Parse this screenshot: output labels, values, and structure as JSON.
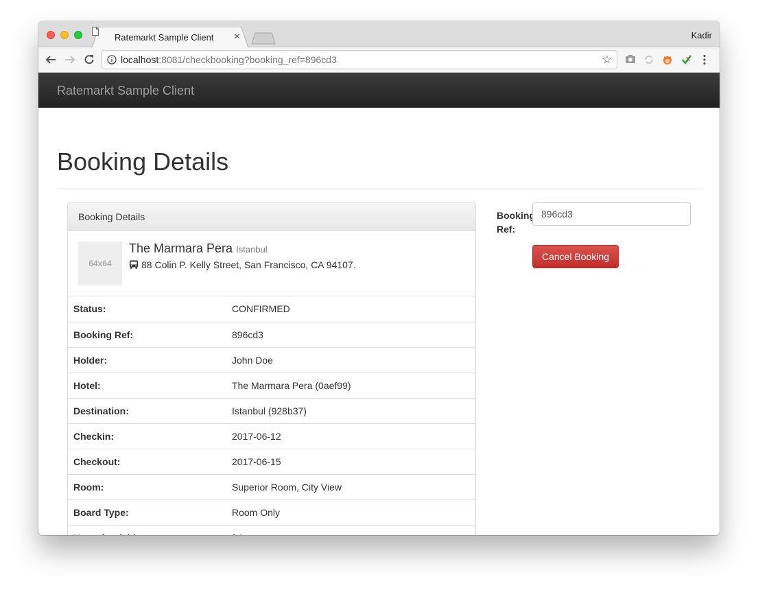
{
  "browser": {
    "tab_title": "Ratemarkt Sample Client",
    "profile_name": "Kadir",
    "url_host": "localhost",
    "url_rest": ":8081/checkbooking?booking_ref=896cd3",
    "extensions": [
      "camera-icon",
      "sync-icon",
      "fox-extension-icon",
      "check-extension-icon",
      "menu-dots-icon"
    ]
  },
  "navbar": {
    "brand": "Ratemarkt Sample Client"
  },
  "page": {
    "title": "Booking Details"
  },
  "panel": {
    "heading": "Booking Details",
    "thumbnail_label": "64x64",
    "hotel_name": "The Marmara Pera",
    "hotel_city": "Istanbul",
    "hotel_address": "88 Colin P. Kelly Street, San Francisco, CA 94107.",
    "rows": [
      {
        "label": "Status:",
        "value": "CONFIRMED"
      },
      {
        "label": "Booking Ref:",
        "value": "896cd3"
      },
      {
        "label": "Holder:",
        "value": "John Doe"
      },
      {
        "label": "Hotel:",
        "value": "The Marmara Pera (0aef99)"
      },
      {
        "label": "Destination:",
        "value": "Istanbul (928b37)"
      },
      {
        "label": "Checkin:",
        "value": "2017-06-12"
      },
      {
        "label": "Checkout:",
        "value": "2017-06-15"
      },
      {
        "label": "Room:",
        "value": "Superior Room, City View"
      },
      {
        "label": "Board Type:",
        "value": "Room Only"
      },
      {
        "label": "Nonrefundable:",
        "value": "false"
      }
    ]
  },
  "form": {
    "label": "Booking Ref:",
    "input_value": "896cd3",
    "cancel_label": "Cancel Booking"
  }
}
